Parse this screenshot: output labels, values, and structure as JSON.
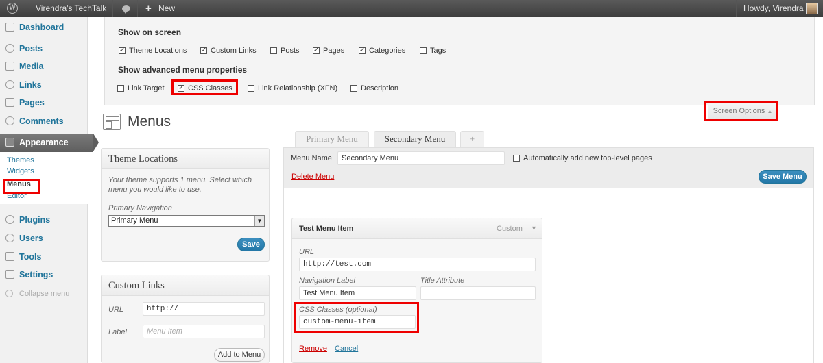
{
  "admin_bar": {
    "site_name": "Virendra's TechTalk",
    "new_label": "New",
    "howdy": "Howdy, Virendra"
  },
  "sidebar": {
    "items": [
      {
        "label": "Dashboard",
        "icon": "home-icon"
      },
      {
        "label": "Posts",
        "icon": "pin-icon"
      },
      {
        "label": "Media",
        "icon": "media-icon"
      },
      {
        "label": "Links",
        "icon": "link-icon"
      },
      {
        "label": "Pages",
        "icon": "page-icon"
      },
      {
        "label": "Comments",
        "icon": "comment-icon"
      },
      {
        "label": "Appearance",
        "icon": "appearance-icon"
      },
      {
        "label": "Plugins",
        "icon": "plug-icon"
      },
      {
        "label": "Users",
        "icon": "users-icon"
      },
      {
        "label": "Tools",
        "icon": "tools-icon"
      },
      {
        "label": "Settings",
        "icon": "settings-icon"
      }
    ],
    "submenu": [
      "Themes",
      "Widgets",
      "Menus",
      "Editor"
    ],
    "collapse": "Collapse menu"
  },
  "screen_options": {
    "show_on_screen": "Show on screen",
    "options": [
      {
        "label": "Theme Locations",
        "checked": true
      },
      {
        "label": "Custom Links",
        "checked": true
      },
      {
        "label": "Posts",
        "checked": false
      },
      {
        "label": "Pages",
        "checked": true
      },
      {
        "label": "Categories",
        "checked": true
      },
      {
        "label": "Tags",
        "checked": false
      }
    ],
    "advanced_heading": "Show advanced menu properties",
    "advanced": [
      {
        "label": "Link Target",
        "checked": false
      },
      {
        "label": "CSS Classes",
        "checked": true
      },
      {
        "label": "Link Relationship (XFN)",
        "checked": false
      },
      {
        "label": "Description",
        "checked": false
      }
    ],
    "tab_label": "Screen Options"
  },
  "page": {
    "title": "Menus"
  },
  "theme_locations": {
    "title": "Theme Locations",
    "description": "Your theme supports 1 menu. Select which menu you would like to use.",
    "location_label": "Primary Navigation",
    "selected_menu": "Primary Menu",
    "save_label": "Save"
  },
  "custom_links": {
    "title": "Custom Links",
    "url_label": "URL",
    "url_value": "http://",
    "label_label": "Label",
    "label_placeholder": "Menu Item",
    "add_label": "Add to Menu"
  },
  "menu_tabs": [
    "Primary Menu",
    "Secondary Menu",
    "+"
  ],
  "menu_editor": {
    "name_label": "Menu Name",
    "name_value": "Secondary Menu",
    "auto_add_label": "Automatically add new top-level pages",
    "delete_label": "Delete Menu",
    "save_label": "Save Menu"
  },
  "menu_item": {
    "title": "Test Menu Item",
    "type": "Custom",
    "url_label": "URL",
    "url_value": "http://test.com",
    "nav_label_label": "Navigation Label",
    "nav_label_value": "Test Menu Item",
    "title_attr_label": "Title Attribute",
    "title_attr_value": "",
    "css_label": "CSS Classes (optional)",
    "css_value": "custom-menu-item",
    "remove_label": "Remove",
    "separator": "|",
    "cancel_label": "Cancel"
  },
  "colors": {
    "highlight": "#e00000",
    "link": "#21759b",
    "admin_bar": "#464646"
  }
}
